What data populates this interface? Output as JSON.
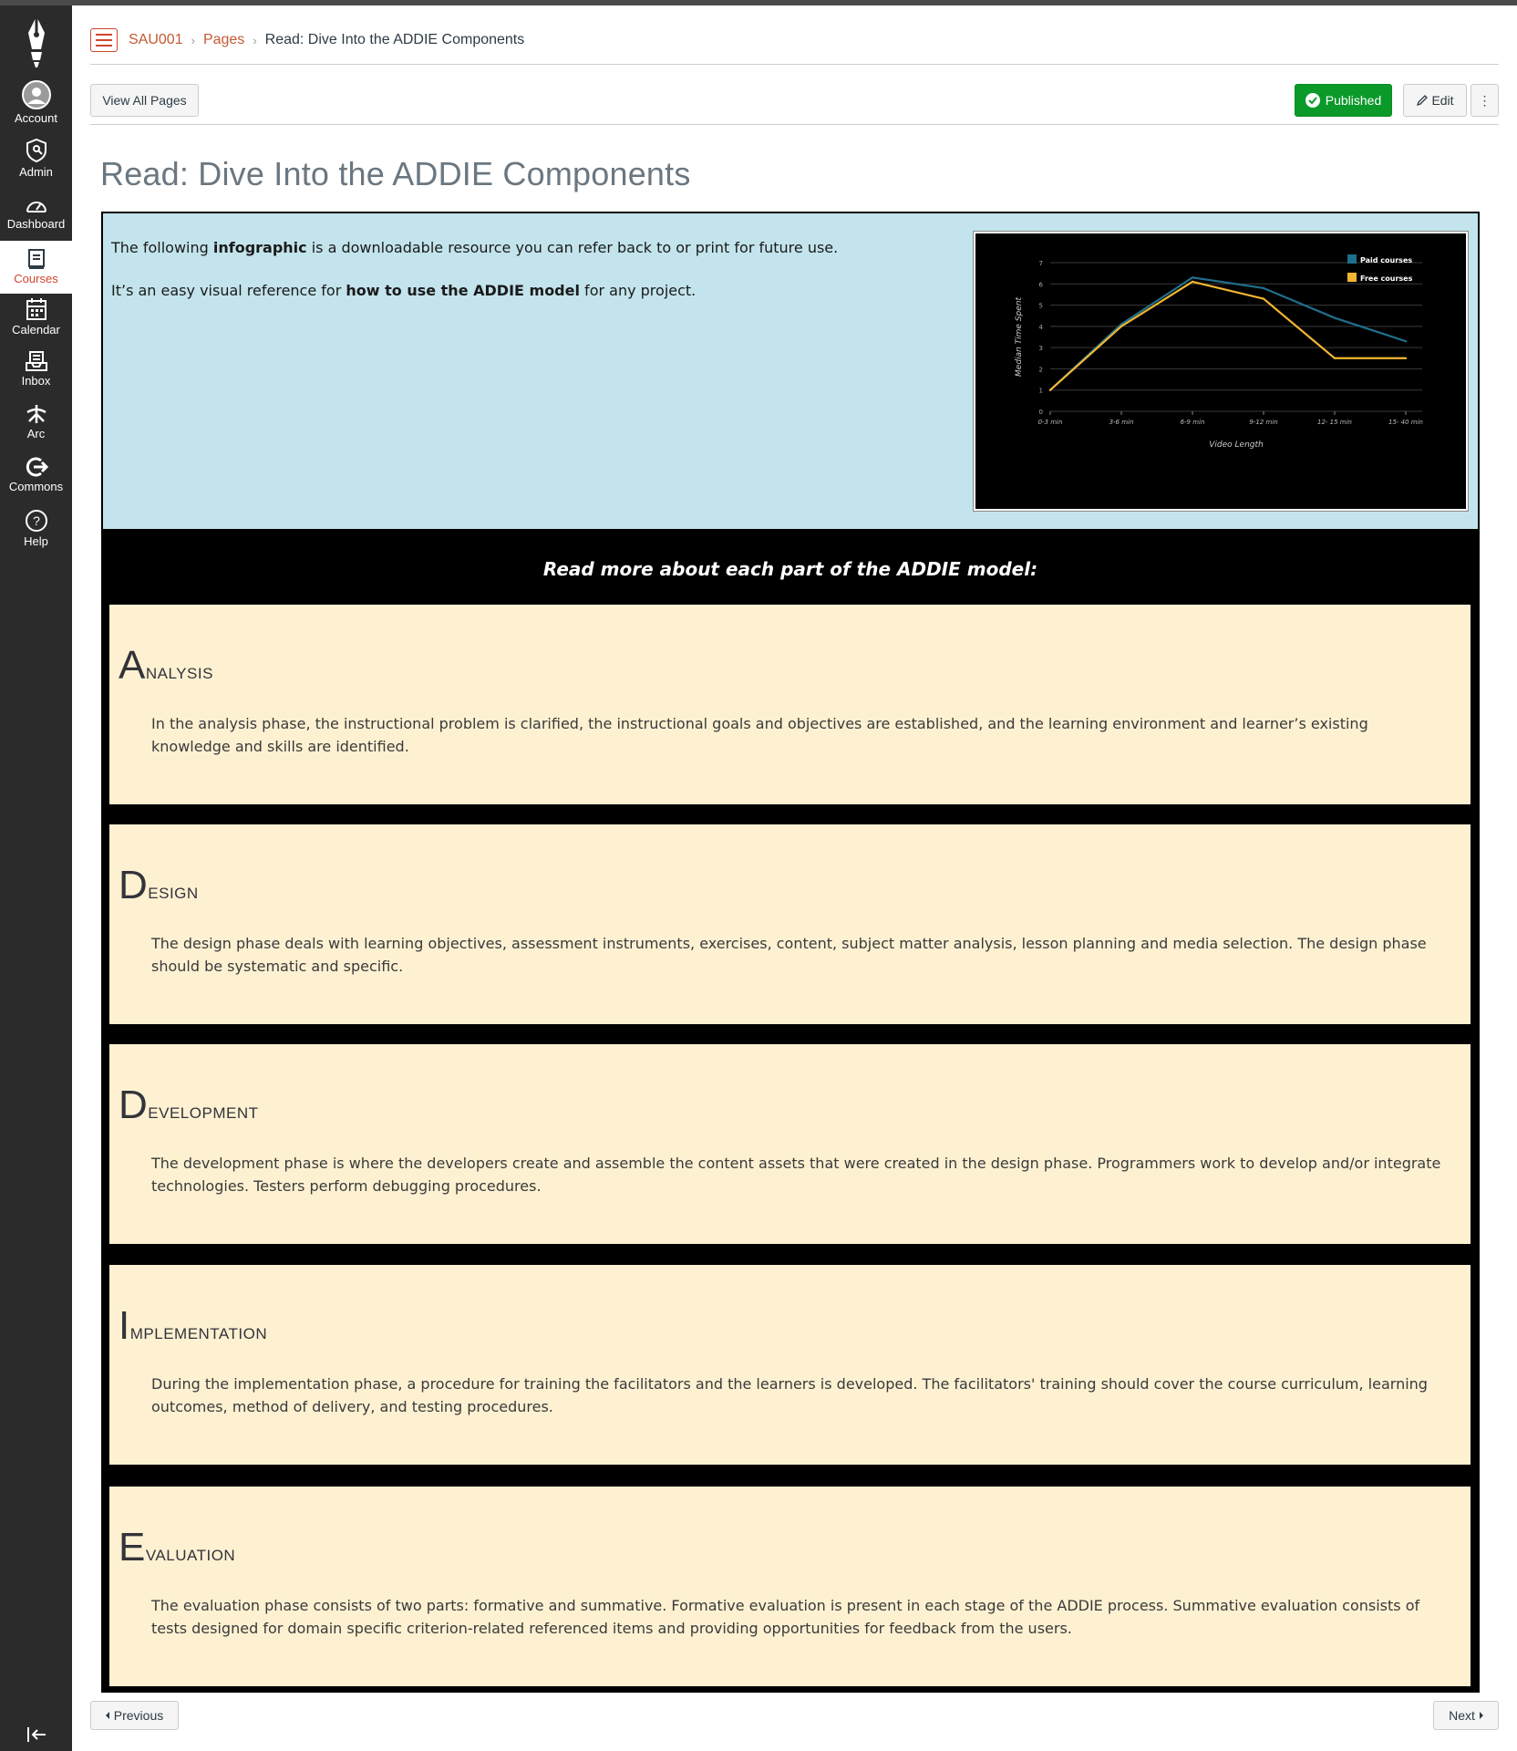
{
  "nav": {
    "items": [
      {
        "label": "Account",
        "icon": "account-icon"
      },
      {
        "label": "Admin",
        "icon": "admin-shield-icon"
      },
      {
        "label": "Dashboard",
        "icon": "dashboard-gauge-icon"
      },
      {
        "label": "Courses",
        "icon": "courses-book-icon",
        "active": true
      },
      {
        "label": "Calendar",
        "icon": "calendar-icon"
      },
      {
        "label": "Inbox",
        "icon": "inbox-icon"
      },
      {
        "label": "Arc",
        "icon": "arc-icon"
      },
      {
        "label": "Commons",
        "icon": "commons-arrow-icon"
      },
      {
        "label": "Help",
        "icon": "help-question-icon"
      }
    ]
  },
  "breadcrumb": {
    "course": "SAU001",
    "section": "Pages",
    "current": "Read: Dive Into the ADDIE Components",
    "separator": "›"
  },
  "toolbar": {
    "view_all_label": "View All Pages",
    "published_label": "Published",
    "edit_label": "Edit",
    "more_label": "⋮"
  },
  "page": {
    "title": "Read: Dive Into the ADDIE Components",
    "intro_line1_a": "The following ",
    "intro_line1_bold": "infographic",
    "intro_line1_b": " is a downloadable resource you can refer back to or print for future use.",
    "intro_line2_a": "It’s an easy visual reference for ",
    "intro_line2_bold": "how to use the ADDIE model",
    "intro_line2_b": " for any project.",
    "black_heading": "Read more about each part of the ADDIE model:"
  },
  "sections": [
    {
      "initial": "A",
      "rest": "nalysis",
      "text": "In the analysis phase, the instructional problem is clarified, the instructional goals and objectives are established, and the learning environment and learner’s existing knowledge and skills are identified."
    },
    {
      "initial": "D",
      "rest": "esign",
      "text": "The design phase deals with learning objectives, assessment instruments, exercises, content, subject matter analysis, lesson planning and media selection. The design phase should be systematic and specific."
    },
    {
      "initial": "D",
      "rest": "evelopment",
      "text": "The development phase is where the developers create and assemble the content assets that were created in the design phase. Programmers work to develop and/or integrate technologies. Testers perform debugging procedures."
    },
    {
      "initial": "I",
      "rest": "mplementation",
      "text": "During the implementation phase, a procedure for training the facilitators and the learners is developed. The facilitators' training should cover the course curriculum, learning outcomes, method of delivery, and testing procedures."
    },
    {
      "initial": "E",
      "rest": "valuation",
      "text": "The evaluation phase consists of two parts: formative and summative. Formative evaluation is present in each stage of the ADDIE process. Summative evaluation consists of tests designed for domain specific criterion-related referenced items and providing opportunities for feedback from the users."
    }
  ],
  "footer": {
    "previous_label": "Previous",
    "next_label": "Next"
  },
  "colors": {
    "brand": "#d0452f",
    "published": "#0b9a2a",
    "intro_bg": "#c3e4ec",
    "card_bg": "#fdf1d2",
    "paid_series": "#1f6f8b",
    "free_series": "#f2b632"
  },
  "chart_data": {
    "type": "line",
    "categories": [
      "0-3 min",
      "3-6 min",
      "6-9 min",
      "9-12 min",
      "12- 15 min",
      "15- 40 min"
    ],
    "series": [
      {
        "name": "Paid courses",
        "values": [
          1,
          4.1,
          6.3,
          5.8,
          4.4,
          3.3
        ],
        "color": "#1f6f8b"
      },
      {
        "name": "Free courses",
        "values": [
          1,
          4.0,
          6.1,
          5.3,
          2.5,
          2.5
        ],
        "color": "#f2b632"
      }
    ],
    "xlabel": "Video Length",
    "ylabel": "Median Time Spent",
    "yticks": [
      "0",
      "1",
      "2",
      "3",
      "4",
      "5",
      "6",
      "7"
    ],
    "ylim": [
      0,
      7
    ],
    "grid": true,
    "legend": "top-right"
  }
}
